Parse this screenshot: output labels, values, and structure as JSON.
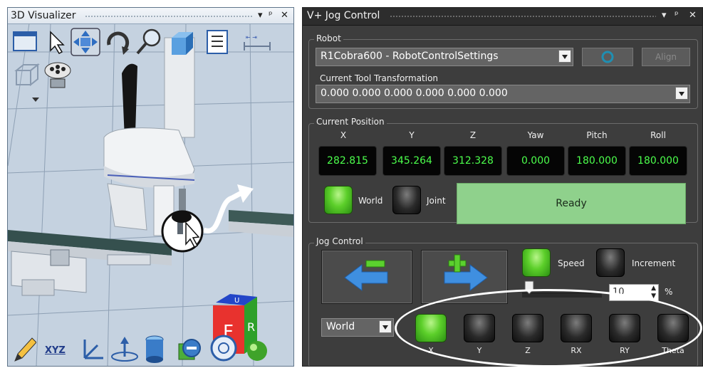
{
  "visualizer": {
    "title": "3D Visualizer",
    "cube_labels": {
      "front": "F",
      "right": "R",
      "top": "U"
    },
    "toolbar_top": [
      "window-icon",
      "pointer-icon",
      "pan-icon",
      "rotate-icon",
      "zoom-icon",
      "cube-view-icon",
      "edit-list-icon",
      "measure-icon"
    ],
    "toolbar_bottom": [
      "edit-icon",
      "xyz-axes-icon",
      "coordinate-frame-icon",
      "ground-plane-icon",
      "cylinder-icon",
      "remove-object-icon",
      "circle-icon",
      "sphere-icon"
    ],
    "xyz_label": "XYZ"
  },
  "jog": {
    "title": "V+ Jog Control",
    "robot": {
      "group_label": "Robot",
      "selected": "R1Cobra600  -  RobotControlSettings",
      "align_label": "Align",
      "tool_label": "Current Tool Transformation",
      "tool_value": "0.000 0.000 0.000 0.000 0.000 0.000"
    },
    "position": {
      "group_label": "Current Position",
      "headers": [
        "X",
        "Y",
        "Z",
        "Yaw",
        "Pitch",
        "Roll"
      ],
      "values": [
        "282.815",
        "345.264",
        "312.328",
        "0.000",
        "180.000",
        "180.000"
      ],
      "world_label": "World",
      "joint_label": "Joint",
      "status": "Ready"
    },
    "control": {
      "group_label": "Jog Control",
      "speed_label": "Speed",
      "increment_label": "Increment",
      "speed_value": "10",
      "percent": "%",
      "frame": "World",
      "axes": [
        "X",
        "Y",
        "Z",
        "RX",
        "RY",
        "Theta"
      ]
    }
  }
}
